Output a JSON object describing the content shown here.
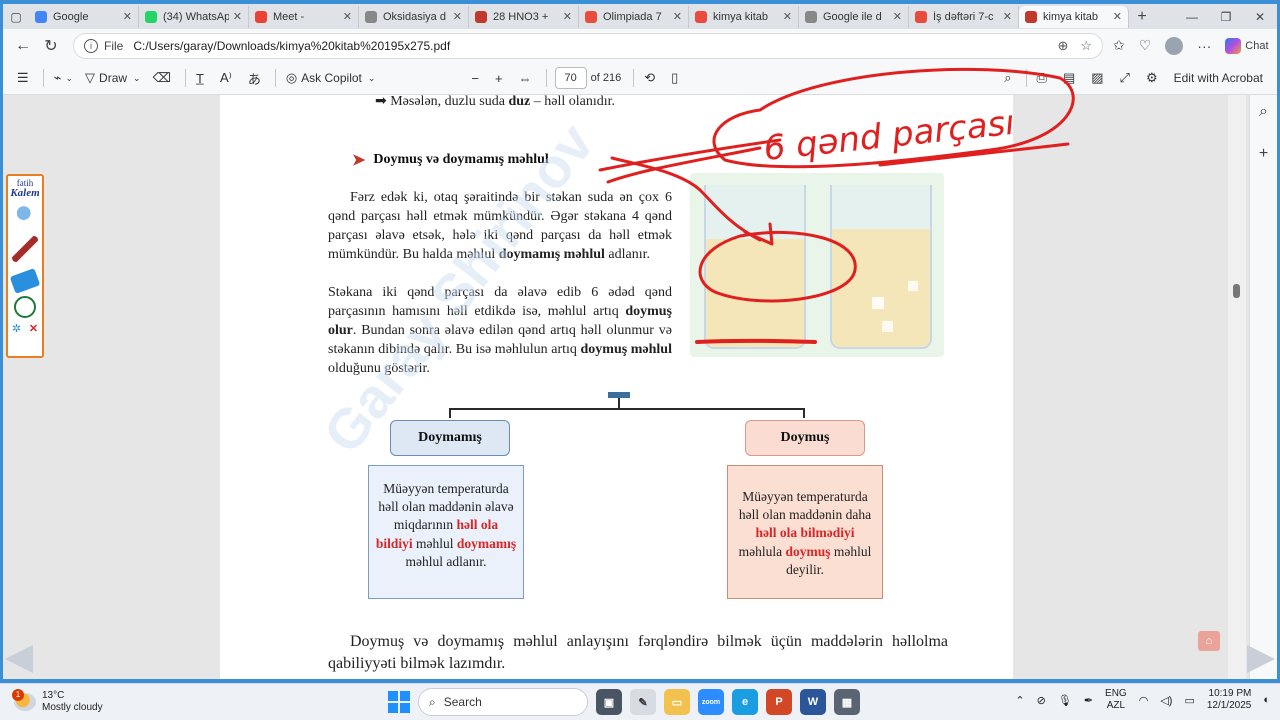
{
  "tabs": [
    {
      "label": "Google",
      "color": "#4285f4",
      "active": false
    },
    {
      "label": "(34) WhatsApp",
      "color": "#25d366",
      "active": false
    },
    {
      "label": "Meet -",
      "color": "#ea4335",
      "active": false
    },
    {
      "label": "Oksidasiya d",
      "color": "#888888",
      "active": false
    },
    {
      "label": "28 HNO3 +",
      "color": "#c0392b",
      "active": false
    },
    {
      "label": "Olimpiada 7",
      "color": "#e74c3c",
      "active": false
    },
    {
      "label": "kimya kitab",
      "color": "#e74c3c",
      "active": false
    },
    {
      "label": "Google ile d",
      "color": "#888888",
      "active": false
    },
    {
      "label": "İş dəftəri 7-c",
      "color": "#e74c3c",
      "active": false
    },
    {
      "label": "kimya kitab",
      "color": "#c0392b",
      "active": true
    }
  ],
  "address": {
    "file_label": "File",
    "url": "C:/Users/garay/Downloads/kimya%20kitab%20195x275.pdf",
    "chat_label": "Chat"
  },
  "pdf_toolbar": {
    "draw_label": "Draw",
    "ask_copilot_label": "Ask Copilot",
    "page_number": "70",
    "page_total": "of 216",
    "edit_acrobat_label": "Edit with Acrobat"
  },
  "kalem": {
    "brand_top": "fatih",
    "brand_bottom": "Kalem"
  },
  "page": {
    "top_line_prefix": "➡ Məsələn, duzlu suda ",
    "top_line_bold": "duz",
    "top_line_suffix": " – həll olanıdır.",
    "heading": "Doymuş və doymamış məhlul",
    "para1": {
      "text1": "Fərz edək ki, otaq şəraitində bir stəkan suda ən çox 6 qənd parçası həll etmək mümkündür. Əgər stəkana 4 qənd parçası əlavə etsək, hələ iki qənd parçası da həll etmək mümkündür. Bu halda məhlul ",
      "bold1": "doymamış məhlul",
      "text2": " adlanır."
    },
    "para2": {
      "text1": "Stəkana iki qənd parçası da əlavə edib 6 ədəd qənd parçasının hamısını həll etdikdə isə, məhlul artıq ",
      "bold1": "doymuş olur",
      "text2": ". Bundan sonra əlavə edilən qənd artıq həll olunmur və stəkanın dibində qalır. Bu isə məhlulun artıq ",
      "bold2": "doymuş məhlul",
      "text3": " olduğunu göstərir."
    },
    "diagram": {
      "left_node": "Doymamış",
      "right_node": "Doymuş",
      "left_desc": {
        "t1": "Müəyyən temperaturda həll olan maddənin əlavə miqdarının ",
        "r1": "həll ola bildiyi",
        "t2": " məhlul ",
        "r2": "doymamış",
        "t3": " məhlul adlanır."
      },
      "right_desc": {
        "t1": "Müəyyən temperaturda həll olan maddənin daha ",
        "r1": "həll ola bilmədiyi",
        "t2": " məhlula ",
        "r2": "doymuş",
        "t3": " məhlul deyilir."
      }
    },
    "bottom_para": "Doymuş və doymamış məhlul anlayışını fərqləndirə bilmək üçün maddələrin həllolma qabiliyyəti bilmək lazımdır.",
    "watermark": "Garay Shirinov"
  },
  "annotation": {
    "handwritten_text": "6 qənd parçası",
    "ink_color": "#e0201f"
  },
  "taskbar": {
    "weather_badge": "1",
    "temperature": "13°C",
    "weather": "Mostly cloudy",
    "search_label": "Search",
    "lang1": "ENG",
    "lang2": "AZL",
    "time": "10:19 PM",
    "date": "12/1/2025"
  }
}
